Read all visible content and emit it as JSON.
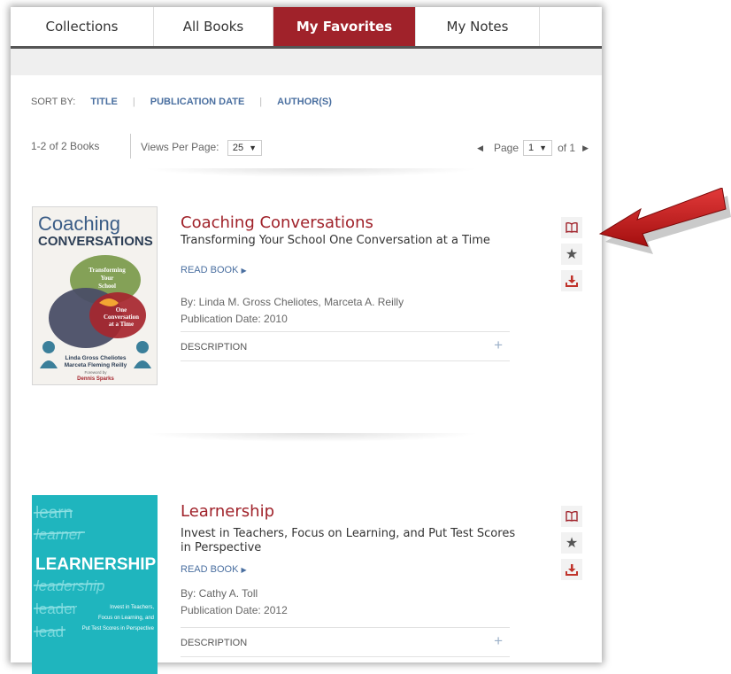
{
  "tabs": [
    {
      "label": "Collections"
    },
    {
      "label": "All Books"
    },
    {
      "label": "My Favorites"
    },
    {
      "label": "My Notes"
    }
  ],
  "active_tab": "My Favorites",
  "sort": {
    "label": "SORT BY:",
    "options": [
      "TITLE",
      "PUBLICATION DATE",
      "AUTHOR(S)"
    ]
  },
  "results": {
    "count_text": "1-2 of 2 Books",
    "views_label": "Views Per Page:",
    "views_value": "25",
    "page_label": "Page",
    "page_value": "1",
    "page_of": "of 1"
  },
  "books": [
    {
      "title": "Coaching Conversations",
      "subtitle": "Transforming Your School One Conversation at a Time",
      "read_label": "READ BOOK",
      "authors": "By: Linda M. Gross Cheliotes, Marceta A. Reilly",
      "pub_date": "Publication Date: 2010",
      "description_label": "DESCRIPTION",
      "cover": {
        "line1": "Coaching",
        "line2": "CONVERSATIONS",
        "bubble1": [
          "Transforming",
          "Your",
          "School"
        ],
        "bubble2": [
          "One",
          "Conversation",
          "at a Time"
        ],
        "authors": [
          "Linda Gross Cheliotes",
          "Marceta Fleming Reilly"
        ],
        "foreword_label": "Foreword by",
        "foreword_name": "Dennis Sparks"
      }
    },
    {
      "title": "Learnership",
      "subtitle": "Invest in Teachers, Focus on Learning, and Put Test Scores in Perspective",
      "read_label": "READ BOOK",
      "authors": "By: Cathy A. Toll",
      "pub_date": "Publication Date: 2012",
      "description_label": "DESCRIPTION",
      "cover": {
        "scribbles": [
          "learn",
          "learner",
          "leadership",
          "leader",
          "lead"
        ],
        "title": "LEARNERSHIP",
        "tagline": [
          "Invest in Teachers,",
          "Focus on Learning, and",
          "Put Test Scores in Perspective"
        ]
      }
    }
  ],
  "colors": {
    "brand": "#a0222a",
    "link": "#4a6fa0",
    "arrow": "#c41a1a",
    "learnership_cover": "#1fb5be"
  },
  "icons": [
    "book-icon",
    "star-icon",
    "download-icon",
    "red-arrow-annotation"
  ]
}
